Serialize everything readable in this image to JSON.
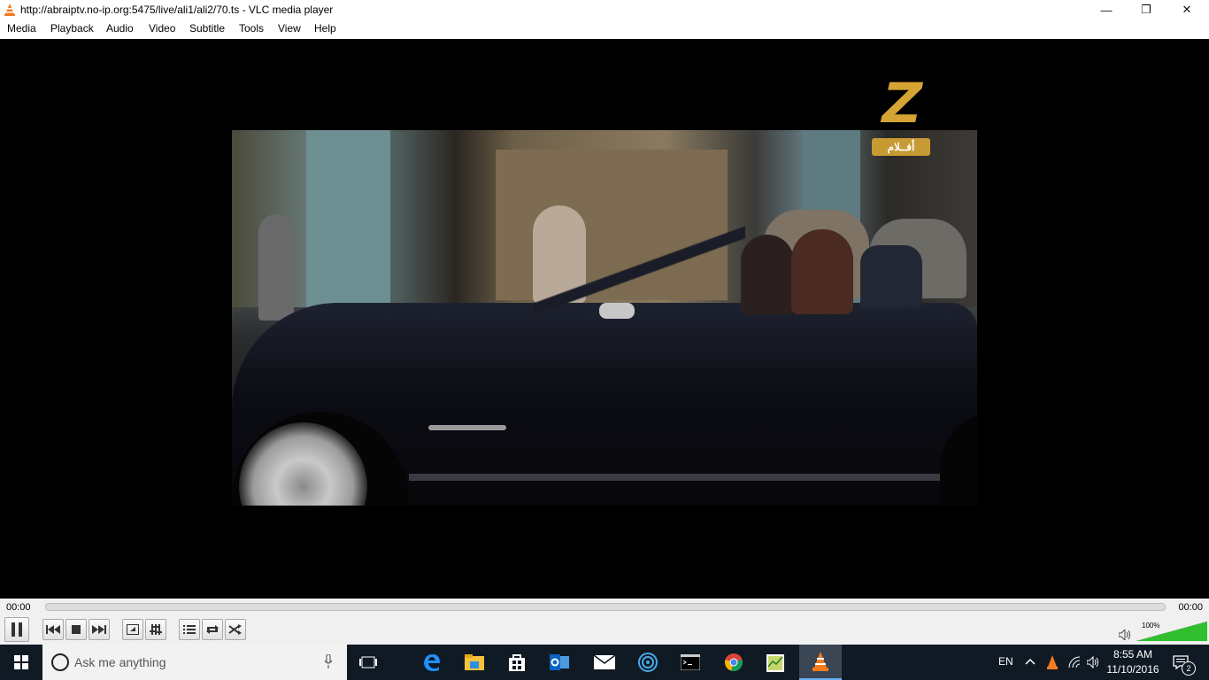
{
  "window": {
    "title": "http://abraiptv.no-ip.org:5475/live/ali1/ali2/70.ts - VLC media player",
    "buttons": {
      "minimize": "—",
      "restore": "❐",
      "close": "✕"
    }
  },
  "menu": [
    "Media",
    "Playback",
    "Audio",
    "Video",
    "Subtitle",
    "Tools",
    "View",
    "Help"
  ],
  "channel_logo": {
    "letter": "Z",
    "badge": "أفــلام"
  },
  "playback": {
    "elapsed": "00:00",
    "total": "00:00",
    "progress": 0,
    "volume_label": "100%",
    "volume": 1.0
  },
  "taskbar": {
    "search_placeholder": "Ask me anything",
    "language": "EN",
    "time": "8:55 AM",
    "date": "11/10/2016",
    "notifications": "2"
  },
  "colors": {
    "vlc_orange": "#f47b20",
    "volume_green": "#2fbf2f",
    "taskbar": "#101a24",
    "logo_gold": "#d6a434"
  }
}
